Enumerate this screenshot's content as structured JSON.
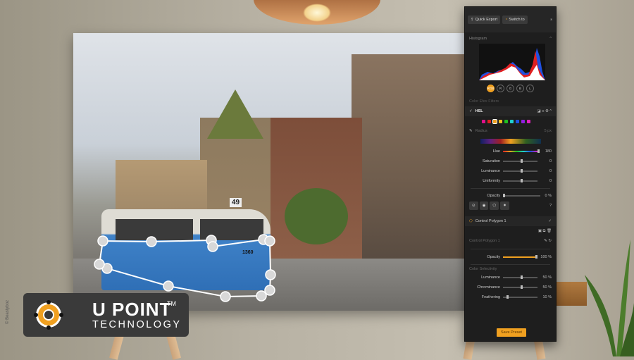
{
  "panel": {
    "quick_export": "Quick Export",
    "switch_to": "Switch to",
    "histogram_title": "Histogram",
    "channels": [
      "RGB",
      "R",
      "G",
      "B",
      "L"
    ],
    "active_channel": "RGB",
    "color_efex_filters": "Color Efex Filters",
    "filter_name": "HSL",
    "color_swatches": [
      "#e0108a",
      "#e02020",
      "#f0a020",
      "#f0c020",
      "#20c020",
      "#20d0d0",
      "#2050e0",
      "#9020e0",
      "#e020c0"
    ],
    "selected_swatch": "#f0a020",
    "radius_label": "Radius",
    "radius_value": "5 px",
    "hsl_sliders": [
      {
        "label": "Hue",
        "value": "180",
        "level": 1.0
      },
      {
        "label": "Saturation",
        "value": "0",
        "level": 0.5
      },
      {
        "label": "Luminance",
        "value": "0",
        "level": 0.5
      },
      {
        "label": "Uniformity",
        "value": "0",
        "level": 0.5
      }
    ],
    "opacity_label": "Opacity",
    "opacity_value": "0 %",
    "control_item": "Control Polygon 1",
    "control_title": "Control Polygon 1",
    "cp_opacity_label": "Opacity",
    "cp_opacity_value": "100 %",
    "color_selectivity": "Color Selectivity",
    "selectivity": [
      {
        "label": "Luminance",
        "value": "50 %",
        "level": 0.5
      },
      {
        "label": "Chrominance",
        "value": "50 %",
        "level": 0.5
      },
      {
        "label": "Feathering",
        "value": "10 %",
        "level": 0.1
      }
    ],
    "save_preset": "Save Preset",
    "accent": "#f0a020"
  },
  "photo": {
    "tram_number": "49",
    "tram_id": "1360"
  },
  "logo": {
    "line1": "U POINT",
    "tm": "TM",
    "line2": "TECHNOLOGY"
  },
  "credit": "© Beastyboz"
}
